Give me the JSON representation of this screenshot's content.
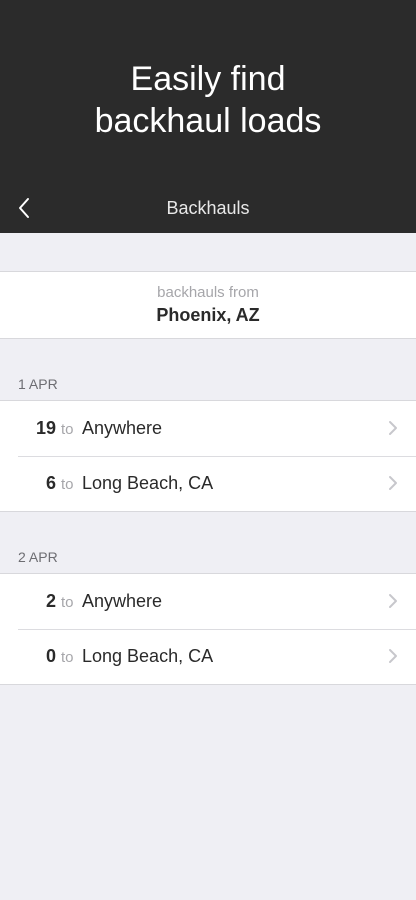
{
  "hero": {
    "line1": "Easily find",
    "line2": "backhaul loads"
  },
  "nav": {
    "title": "Backhauls",
    "back_icon": "chevron-left-icon"
  },
  "origin": {
    "label": "backhauls from",
    "city": "Phoenix, AZ"
  },
  "sections": [
    {
      "date": "1 APR",
      "rows": [
        {
          "count": "19",
          "to": "to",
          "destination": "Anywhere"
        },
        {
          "count": "6",
          "to": "to",
          "destination": "Long Beach, CA"
        }
      ]
    },
    {
      "date": "2 APR",
      "rows": [
        {
          "count": "2",
          "to": "to",
          "destination": "Anywhere"
        },
        {
          "count": "0",
          "to": "to",
          "destination": "Long Beach, CA"
        }
      ]
    }
  ],
  "colors": {
    "hero_bg": "#2b2b2b",
    "page_bg": "#efeff4",
    "chevron": "#c7c7cc"
  }
}
